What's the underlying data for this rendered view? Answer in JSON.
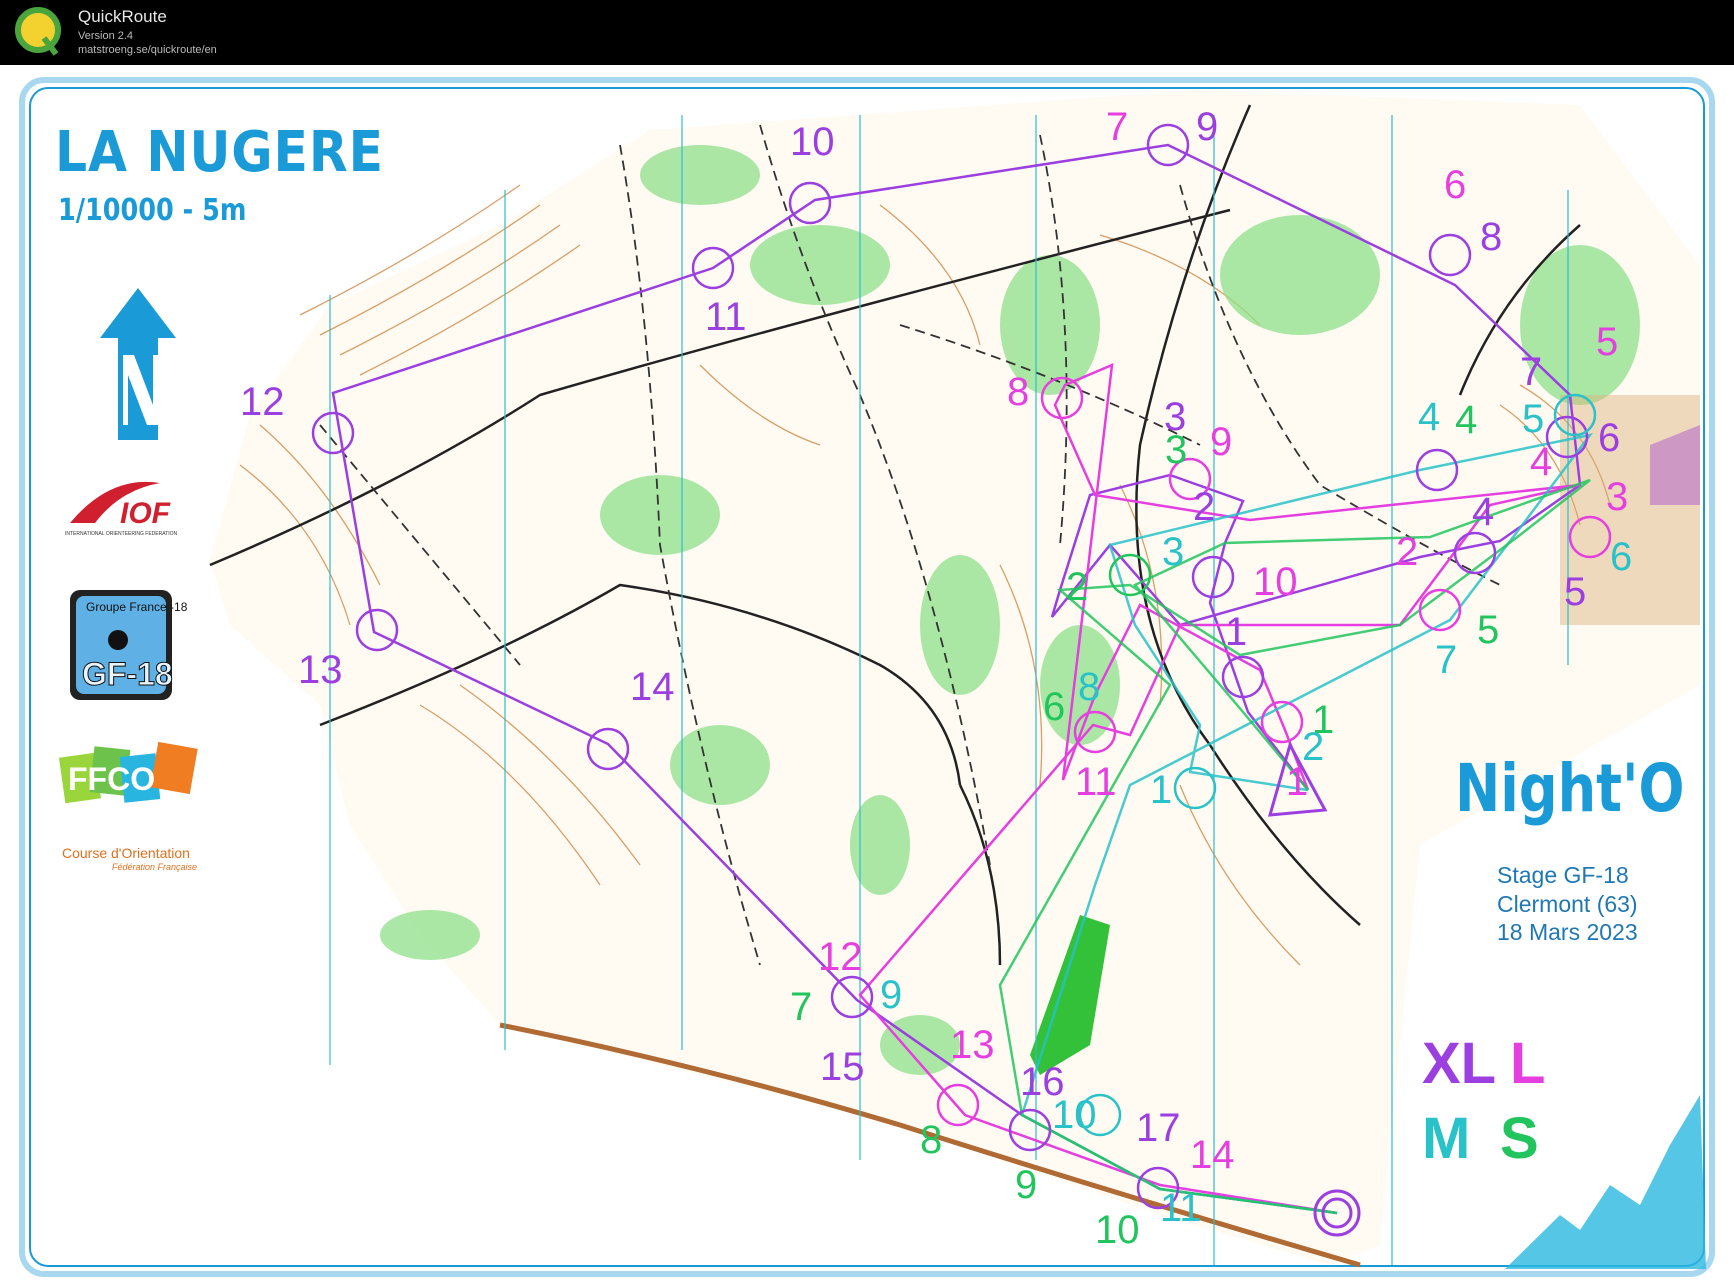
{
  "app": {
    "name": "QuickRoute",
    "version": "Version 2.4",
    "url": "matstroeng.se/quickroute/en"
  },
  "map": {
    "title": "LA NUGERE",
    "scale": "1/10000 - 5m",
    "event_title": "Night'O",
    "event_lines": [
      "Stage GF-18",
      "Clermont (63)",
      "18 Mars 2023"
    ],
    "classes": {
      "xl": "XL",
      "l": "L",
      "m": "M",
      "s": "S"
    },
    "logos": {
      "iof": "IOF",
      "iof_caption": "INTERNATIONAL ORIENTEERING FEDERATION",
      "gf18": "GF-18",
      "gf18_top": "Groupe France -18",
      "ffco": "FFCO",
      "ffco_caption": "Course d'Orientation",
      "ffco_sub": "Fédération Française"
    },
    "colors": {
      "xl": "#9b3fe0",
      "l": "#e63fe0",
      "m": "#28c2c8",
      "s": "#22c45e",
      "frame": "#1a9ad6"
    },
    "icons": [
      "north-arrow-icon",
      "start-triangle-icon",
      "finish-circle-icon"
    ]
  },
  "courses": {
    "xl": {
      "color": "#9b3fe0",
      "controls": [
        "1",
        "2",
        "3",
        "4",
        "5",
        "6",
        "7",
        "8",
        "9",
        "10",
        "11",
        "12",
        "13",
        "14",
        "15",
        "16",
        "17"
      ]
    },
    "l": {
      "color": "#e63fe0",
      "controls": [
        "1",
        "2",
        "3",
        "4",
        "5",
        "6",
        "7",
        "8",
        "9",
        "10",
        "11",
        "12",
        "13",
        "14"
      ]
    },
    "m": {
      "color": "#28c2c8",
      "controls": [
        "1",
        "2",
        "3",
        "4",
        "5",
        "6",
        "7",
        "8",
        "9",
        "10",
        "11"
      ]
    },
    "s": {
      "color": "#22c45e",
      "controls": [
        "1",
        "2",
        "3",
        "4",
        "5",
        "6",
        "7",
        "8",
        "9",
        "10"
      ]
    }
  }
}
